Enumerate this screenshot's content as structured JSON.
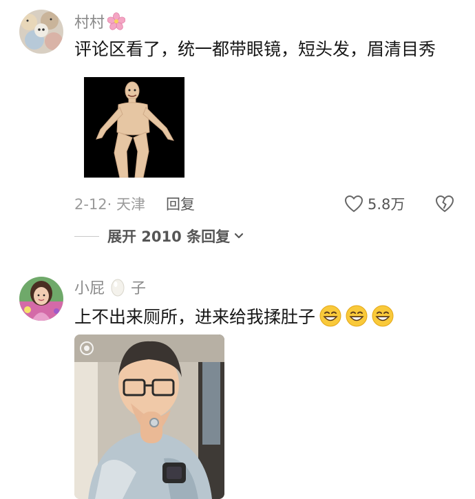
{
  "comments": [
    {
      "username": "村村",
      "text": "评论区看了，统一都带眼镜，短头发，眉清目秀",
      "date_location": "2-12· 天津",
      "reply_label": "回复",
      "likes": "5.8万",
      "expand_label": "展开 2010 条回复"
    },
    {
      "username_prefix": "小屁",
      "username_suffix": "子",
      "text": "上不出来厕所，进来给我揉肚子"
    }
  ],
  "icons": {
    "flower": "cherry-blossom-emoji",
    "egg": "egg-emoji",
    "grin": "grinning-emoji",
    "heart": "heart-outline-icon",
    "dislike": "broken-heart-icon",
    "chevron": "chevron-down-icon"
  },
  "colors": {
    "username": "#8a8a8a",
    "text": "#161616",
    "meta": "#9a9a9a"
  }
}
